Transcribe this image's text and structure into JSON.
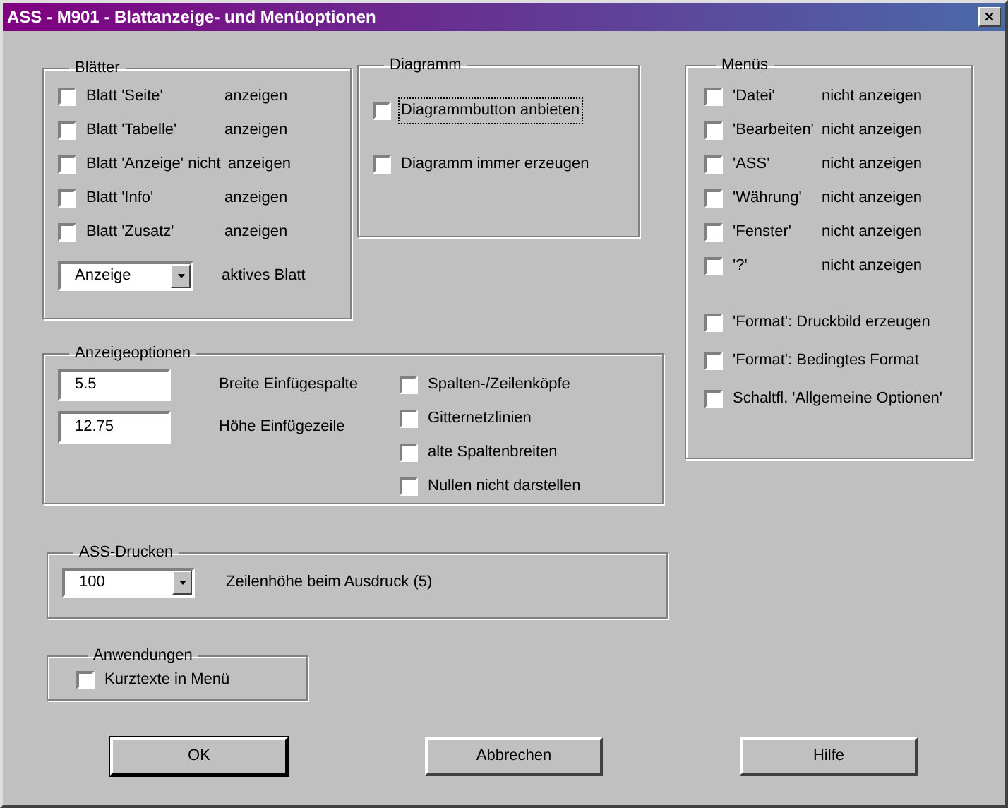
{
  "window": {
    "title": "ASS - M901 - Blattanzeige- und Menüoptionen",
    "close": "✕"
  },
  "sheets": {
    "title": "Blätter",
    "items": [
      {
        "label": "Blatt 'Seite'",
        "suffix": "anzeigen",
        "checked": false
      },
      {
        "label": "Blatt 'Tabelle'",
        "suffix": "anzeigen",
        "checked": false
      },
      {
        "label": "Blatt 'Anzeige' nicht",
        "suffix": "anzeigen",
        "checked": false
      },
      {
        "label": "Blatt 'Info'",
        "suffix": "anzeigen",
        "checked": false
      },
      {
        "label": "Blatt 'Zusatz'",
        "suffix": "anzeigen",
        "checked": false
      }
    ],
    "active_sheet": {
      "value": "Anzeige",
      "label": "aktives Blatt"
    }
  },
  "diagram": {
    "title": "Diagramm",
    "items": [
      {
        "label": "Diagrammbutton anbieten",
        "checked": false,
        "focused": true
      },
      {
        "label": "Diagramm immer erzeugen",
        "checked": false,
        "focused": false
      }
    ]
  },
  "menus": {
    "title": "Menüs",
    "items": [
      {
        "label": "'Datei'",
        "suffix": "nicht anzeigen",
        "checked": false
      },
      {
        "label": "'Bearbeiten'",
        "suffix": "nicht anzeigen",
        "checked": false
      },
      {
        "label": "'ASS'",
        "suffix": "nicht anzeigen",
        "checked": false
      },
      {
        "label": "'Währung'",
        "suffix": "nicht anzeigen",
        "checked": false
      },
      {
        "label": "'Fenster'",
        "suffix": "nicht anzeigen",
        "checked": false
      },
      {
        "label": "'?'",
        "suffix": "nicht anzeigen",
        "checked": false
      }
    ],
    "extra_items": [
      {
        "label": "'Format': Druckbild erzeugen",
        "checked": false
      },
      {
        "label": "'Format': Bedingtes Format",
        "checked": false
      },
      {
        "label": "Schaltfl. 'Allgemeine Optionen'",
        "checked": false
      }
    ]
  },
  "display_options": {
    "title": "Anzeigeoptionen",
    "fields": [
      {
        "value": "5.5",
        "label": "Breite Einfügespalte"
      },
      {
        "value": "12.75",
        "label": "Höhe Einfügezeile"
      }
    ],
    "items": [
      {
        "label": "Spalten-/Zeilenköpfe",
        "checked": false
      },
      {
        "label": "Gitternetzlinien",
        "checked": false
      },
      {
        "label": "alte Spaltenbreiten",
        "checked": false
      },
      {
        "label": "Nullen nicht darstellen",
        "checked": false
      }
    ]
  },
  "printing": {
    "title": "ASS-Drucken",
    "value": "100",
    "label": "Zeilenhöhe beim Ausdruck (5)"
  },
  "applications": {
    "title": "Anwendungen",
    "items": [
      {
        "label": "Kurztexte in Menü",
        "checked": false
      }
    ]
  },
  "buttons": [
    {
      "label": "OK",
      "default": true
    },
    {
      "label": "Abbrechen",
      "default": false
    },
    {
      "label": "Hilfe",
      "default": false
    }
  ]
}
